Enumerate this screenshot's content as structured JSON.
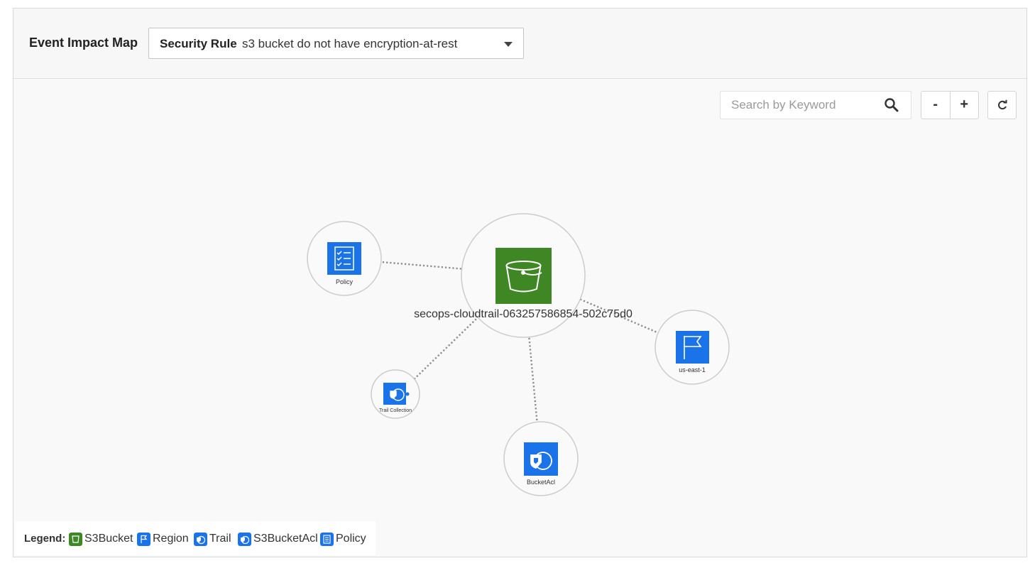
{
  "header": {
    "title": "Event Impact Map",
    "rule_key": "Security Rule",
    "rule_value": "s3 bucket do not have encryption-at-rest"
  },
  "toolbar": {
    "search_placeholder": "Search by Keyword",
    "zoom_out": "-",
    "zoom_in": "+"
  },
  "graph": {
    "center": {
      "label": "secops-cloudtrail-063257586854-502c75d0",
      "icon": "s3-bucket-icon",
      "color": "#3f8624"
    },
    "nodes": [
      {
        "label": "Policy",
        "icon": "policy-icon"
      },
      {
        "label": "us-east-1",
        "icon": "region-flag-icon"
      },
      {
        "label": "Trail Collection",
        "icon": "trail-icon"
      },
      {
        "label": "BucketAcl",
        "icon": "bucket-acl-icon"
      }
    ]
  },
  "legend": {
    "label": "Legend:",
    "items": [
      {
        "label": "S3Bucket",
        "icon": "s3-bucket-icon",
        "color": "#3f8624"
      },
      {
        "label": "Region",
        "icon": "region-flag-icon",
        "color": "#1a73e8"
      },
      {
        "label": "Trail",
        "icon": "trail-icon",
        "color": "#1a73e8"
      },
      {
        "label": "S3BucketAcl",
        "icon": "bucket-acl-icon",
        "color": "#1a73e8"
      },
      {
        "label": "Policy",
        "icon": "policy-icon",
        "color": "#1a73e8"
      }
    ]
  },
  "colors": {
    "accent_blue": "#1a73e8",
    "s3_green": "#3f8624"
  }
}
